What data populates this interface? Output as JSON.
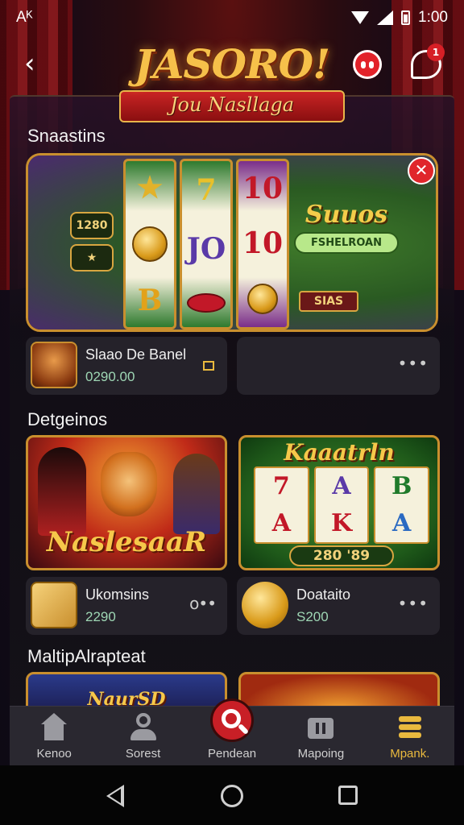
{
  "status_bar": {
    "left_text": "Aᴷ",
    "time": "1:00"
  },
  "header": {
    "logo_title": "JASORO!",
    "logo_subtitle": "Jou Nasllaga",
    "notification_badge": "1"
  },
  "sections": {
    "featured": {
      "title": "Snaastins"
    },
    "designs": {
      "title": "Detgeinos"
    },
    "multiplayer": {
      "title": "MaltipAlrapteat"
    }
  },
  "featured_slot": {
    "left_badge_1": "1280",
    "left_badge_2": "★",
    "reel1": [
      "★",
      "",
      "B"
    ],
    "reel2": [
      "7",
      "JO",
      ""
    ],
    "reel3": [
      "10",
      "10",
      ""
    ],
    "title_art": "Suuos",
    "title_art_sub": "FSHELROAN",
    "button": "SIAS"
  },
  "cards_row1": [
    {
      "name": "Slaao De Banel",
      "amount": "0290.00"
    },
    {
      "name": "",
      "amount": ""
    }
  ],
  "thumbnails_row2": [
    {
      "title": "NaslesaaR"
    },
    {
      "title": "Kaaatrln",
      "reels": [
        "7",
        "A",
        "B",
        "A",
        "K",
        "A"
      ],
      "amount": "280 '89"
    }
  ],
  "cards_row2": [
    {
      "name": "Ukomsins",
      "amount": "2290"
    },
    {
      "name": "Doataito",
      "amount": "S200"
    }
  ],
  "thumbnails_row3": [
    {
      "title": "NaurSD"
    },
    {
      "title": ""
    }
  ],
  "bottom_nav": [
    {
      "label": "Kenoo"
    },
    {
      "label": "Sorest"
    },
    {
      "label": "Pendean"
    },
    {
      "label": "Mapoing"
    },
    {
      "label": "Mpank."
    }
  ],
  "colors": {
    "accent_gold": "#e9b93e",
    "accent_red": "#c81f26",
    "panel_bg": "#25222a"
  }
}
